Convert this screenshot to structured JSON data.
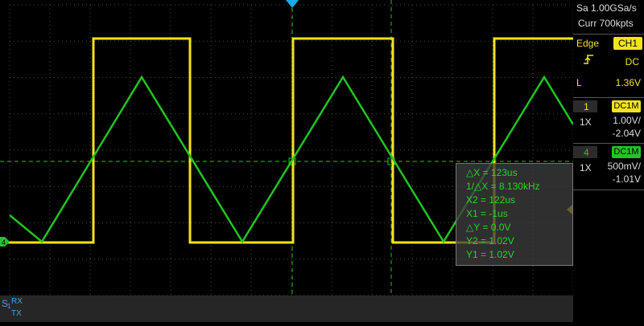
{
  "header": {
    "sample_rate": "Sa 1.00GSa/s",
    "memory_depth": "Curr 700kpts"
  },
  "trigger": {
    "mode": "Edge",
    "source": "CH1",
    "slope_icon": "rising-edge-icon",
    "coupling": "DC",
    "level_label": "L",
    "level": "1.36V"
  },
  "channels": [
    {
      "number": "1",
      "coupling": "DC1M",
      "probe": "1X",
      "scale": "1.00V/",
      "offset": "-2.04V",
      "color": "#f3e31a"
    },
    {
      "number": "4",
      "coupling": "DC1M",
      "probe": "1X",
      "scale": "500mV/",
      "offset": "-1.01V",
      "color": "#21c521"
    }
  ],
  "cursor_measure": {
    "delta_x": "△X = 123us",
    "inv_delta_x": "1/△X = 8.130kHz",
    "x2": "X2 = 122us",
    "x1": "X1 = -1us",
    "delta_y": "△Y = 0.0V",
    "y2": "Y2 = 1.02V",
    "y1": "Y1 = 1.02V"
  },
  "markers": {
    "ch4_ground": "4"
  },
  "serial": {
    "label_s": "S",
    "label_sub": "1",
    "rx": "RX",
    "tx": "TX"
  },
  "colors": {
    "ch1": "#f3e31a",
    "ch4": "#21c521",
    "trigger_marker": "#19a9e6",
    "cursor": "#21c521",
    "grid": "#4a4a4a"
  }
}
